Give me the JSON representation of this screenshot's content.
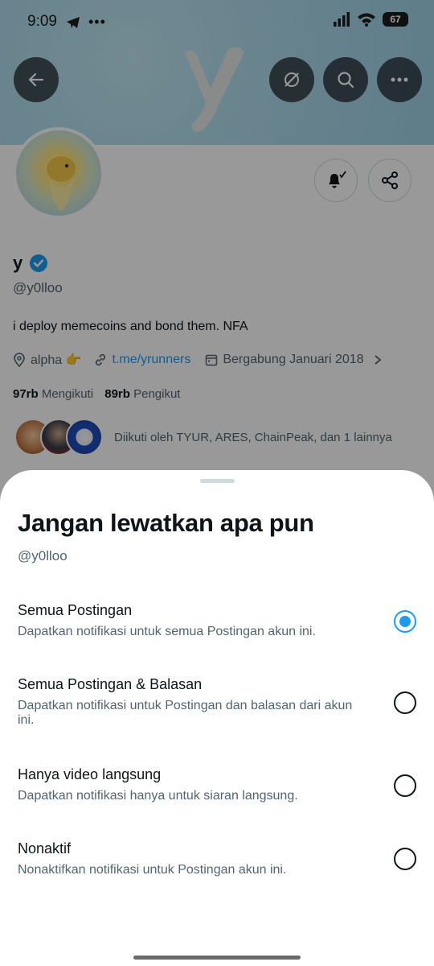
{
  "status_bar": {
    "time": "9:09",
    "battery": "67"
  },
  "profile": {
    "name": "y",
    "handle": "@y0lloo",
    "bio": "i deploy memecoins and bond them. NFA",
    "location": "alpha 👉",
    "link": "t.me/yrunners",
    "joined": "Bergabung Januari 2018",
    "following_count": "97rb",
    "following_label": "Mengikuti",
    "followers_count": "89rb",
    "followers_label": "Pengikut",
    "followed_by": "Diikuti oleh TYUR, ARES, ChainPeak, dan 1 lainnya"
  },
  "sheet": {
    "title": "Jangan lewatkan apa pun",
    "handle": "@y0lloo",
    "options": [
      {
        "title": "Semua Postingan",
        "desc": "Dapatkan notifikasi untuk semua Postingan akun ini.",
        "selected": true
      },
      {
        "title": "Semua Postingan & Balasan",
        "desc": "Dapatkan notifikasi untuk Postingan dan balasan dari akun ini.",
        "selected": false
      },
      {
        "title": "Hanya video langsung",
        "desc": "Dapatkan notifikasi hanya untuk siaran langsung.",
        "selected": false
      },
      {
        "title": "Nonaktif",
        "desc": "Nonaktifkan notifikasi untuk Postingan akun ini.",
        "selected": false
      }
    ]
  },
  "colors": {
    "accent": "#1d9bf0",
    "text_primary": "#0f1419",
    "text_secondary": "#536471",
    "banner": "#aedcec"
  }
}
